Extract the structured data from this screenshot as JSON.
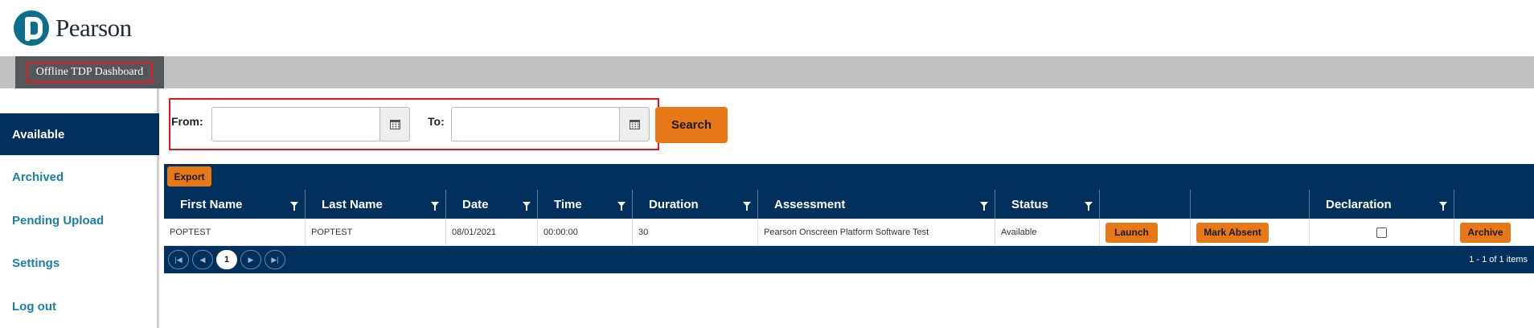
{
  "brand": {
    "name": "Pearson",
    "logo_icon": "pearson-p-logo"
  },
  "header": {
    "dashboard_tab": "Offline TDP Dashboard"
  },
  "sidebar": {
    "items": [
      {
        "label": "Available",
        "active": true
      },
      {
        "label": "Archived"
      },
      {
        "label": "Pending Upload"
      },
      {
        "label": "Settings"
      },
      {
        "label": "Log out"
      }
    ]
  },
  "filter": {
    "from_label": "From:",
    "from_value": "",
    "to_label": "To:",
    "to_value": "",
    "calendar_icon": "calendar-icon",
    "search_label": "Search"
  },
  "grid": {
    "export_label": "Export",
    "columns": [
      "First Name",
      "Last Name",
      "Date",
      "Time",
      "Duration",
      "Assessment",
      "Status",
      "",
      "",
      "Declaration",
      ""
    ],
    "rows": [
      {
        "first_name": "POPTEST",
        "last_name": "POPTEST",
        "date": "08/01/2021",
        "time": "00:00:00",
        "duration": "30",
        "assessment": "Pearson Onscreen Platform Software Test",
        "status": "Available",
        "launch_label": "Launch",
        "mark_absent_label": "Mark Absent",
        "declaration_checked": false,
        "archive_label": "Archive"
      }
    ],
    "pager": {
      "first_icon": "first-page-icon",
      "prev_icon": "prev-page-icon",
      "current_page": "1",
      "next_icon": "next-page-icon",
      "last_icon": "last-page-icon",
      "info": "1 - 1 of 1 items"
    }
  },
  "colors": {
    "navy": "#00305b",
    "orange": "#e77817",
    "link_blue": "#1a7fa6",
    "highlight_red": "#e2191c",
    "bar_gray": "#c1c1c1"
  }
}
